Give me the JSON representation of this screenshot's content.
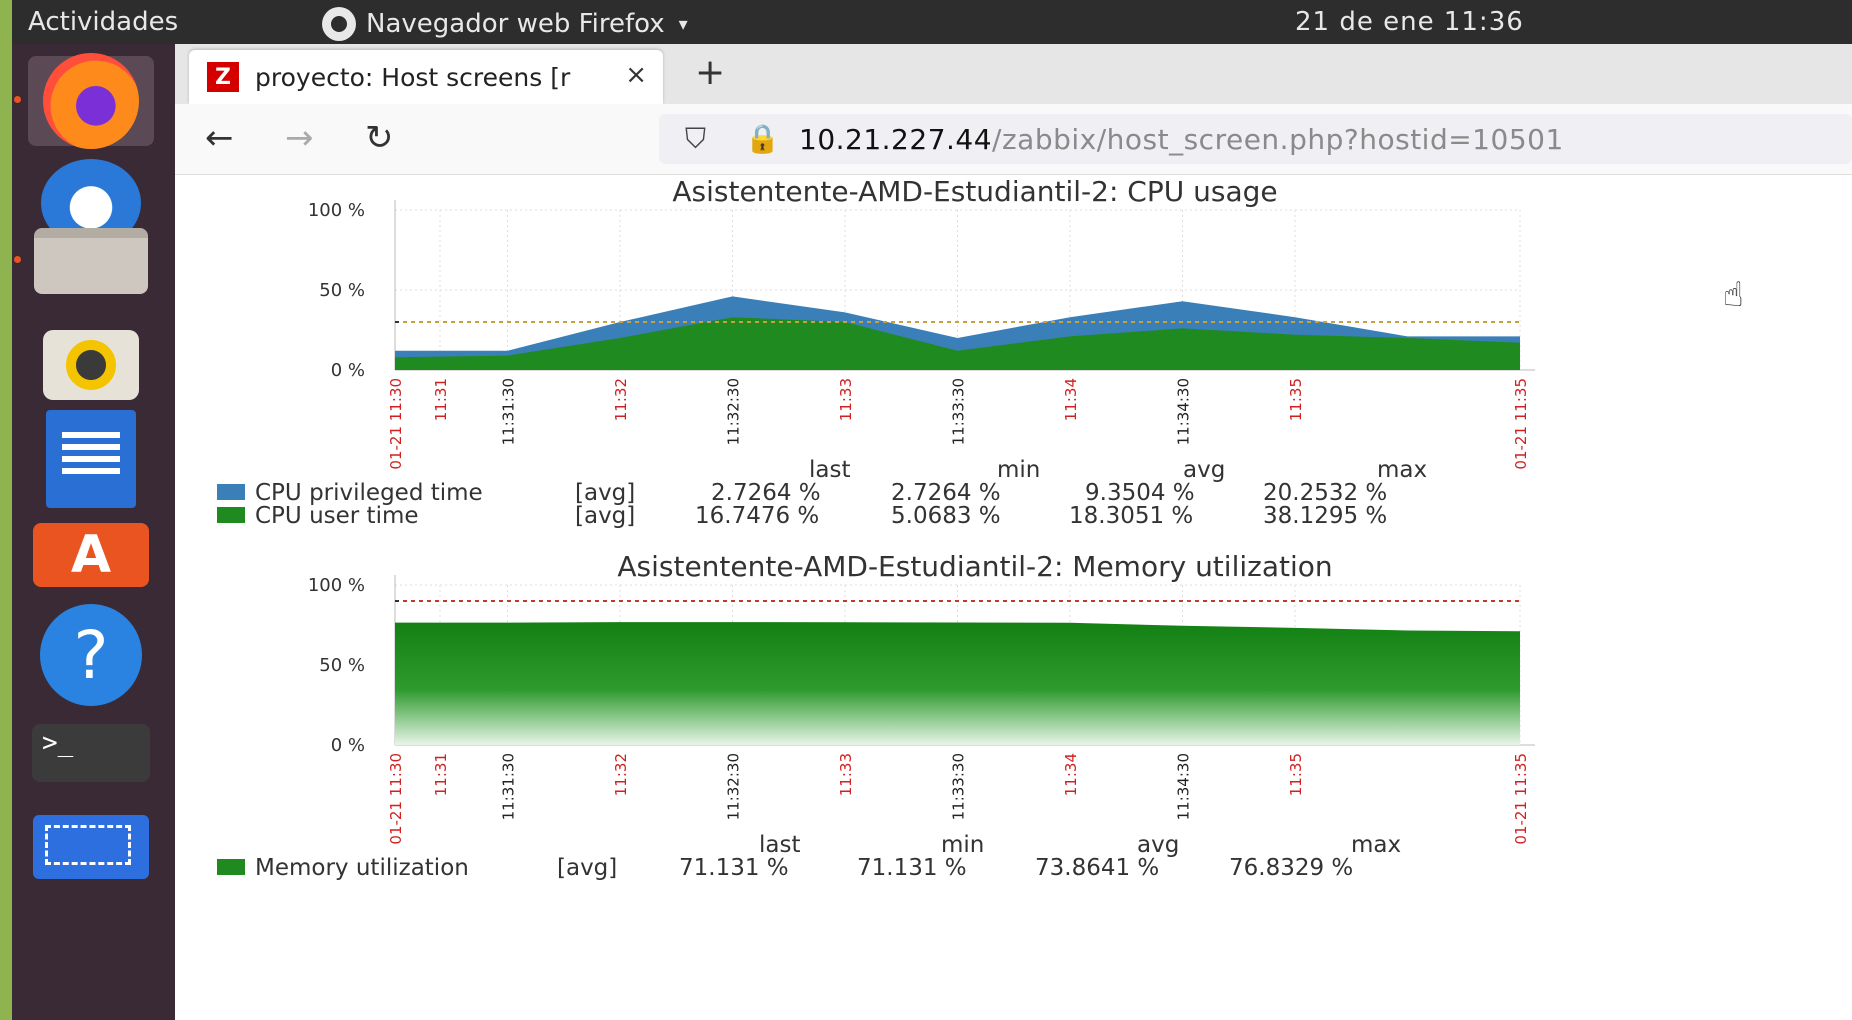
{
  "topbar": {
    "activities": "Actividades",
    "app_name": "Navegador web Firefox",
    "app_caret": "▾",
    "clock": "21 de ene  11:36"
  },
  "dock": {
    "items": [
      "firefox-icon",
      "thunderbird-icon",
      "files-icon",
      "rhythmbox-icon",
      "writer-icon",
      "software-icon",
      "help-icon",
      "terminal-icon",
      "screenshot-icon"
    ],
    "help_glyph": "?",
    "store_glyph": "A",
    "terminal_glyph": ">_"
  },
  "browser": {
    "tab": {
      "favicon": "Z",
      "title": "proyecto: Host screens [r",
      "close": "×"
    },
    "new_tab": "+",
    "nav": {
      "back": "←",
      "forward": "→",
      "reload": "↻"
    },
    "url_icons": {
      "shield": "⛉",
      "lock": "🔒"
    },
    "url": {
      "host": "10.21.227.44",
      "path": "/zabbix/host_screen.php?hostid=10501"
    }
  },
  "colors": {
    "accent": "#e95420",
    "series_blue": "#3a7fb8",
    "series_green": "#1f8a1f",
    "trigger_line": "#c8a03c",
    "time_red": "#d02020"
  },
  "cursor": "☝",
  "chart_data": [
    {
      "type": "area",
      "title": "Asistentente-AMD-Estudiantil-2: CPU usage",
      "ylim": [
        0,
        100
      ],
      "y_ticks": [
        "100 %",
        "50 %",
        "0 %"
      ],
      "x_ticks": [
        {
          "label": "01-21 11:30",
          "color": "red"
        },
        {
          "label": "11:31",
          "color": "red"
        },
        {
          "label": "11:31:30",
          "color": "black"
        },
        {
          "label": "11:32",
          "color": "red"
        },
        {
          "label": "11:32:30",
          "color": "black"
        },
        {
          "label": "11:33",
          "color": "red"
        },
        {
          "label": "11:33:30",
          "color": "black"
        },
        {
          "label": "11:34",
          "color": "red"
        },
        {
          "label": "11:34:30",
          "color": "black"
        },
        {
          "label": "11:35",
          "color": "red"
        },
        {
          "label": "01-21 11:35",
          "color": "red"
        }
      ],
      "x_minutes": [
        0,
        0.5,
        1.5,
        2.5,
        3.5,
        4.5,
        5.5,
        5.0
      ],
      "trigger_line": 30,
      "total": {
        "x": [
          0,
          0.5,
          1,
          1.5,
          2,
          2.5,
          3,
          3.5,
          4,
          4.5,
          5
        ],
        "values": [
          12,
          12,
          30,
          46,
          36,
          20,
          33,
          43,
          33,
          21,
          21
        ]
      },
      "user": {
        "x": [
          0,
          0.5,
          1,
          1.5,
          2,
          2.5,
          3,
          3.5,
          4,
          4.5,
          5
        ],
        "values": [
          8,
          9,
          20,
          33,
          30,
          12,
          21,
          26,
          22,
          20,
          17
        ]
      },
      "legend_headers": [
        "last",
        "min",
        "avg",
        "max"
      ],
      "series": [
        {
          "name": "CPU privileged time",
          "func": "[avg]",
          "last": "2.7264 %",
          "min": "2.7264 %",
          "avg": "9.3504 %",
          "max": "20.2532 %"
        },
        {
          "name": "CPU user time",
          "func": "[avg]",
          "last": "16.7476 %",
          "min": "5.0683 %",
          "avg": "18.3051 %",
          "max": "38.1295 %"
        }
      ]
    },
    {
      "type": "area",
      "title": "Asistentente-AMD-Estudiantil-2: Memory utilization",
      "ylim": [
        0,
        100
      ],
      "y_ticks": [
        "100 %",
        "50 %",
        "0 %"
      ],
      "x_ticks": [
        {
          "label": "01-21 11:30",
          "color": "red"
        },
        {
          "label": "11:31",
          "color": "red"
        },
        {
          "label": "11:31:30",
          "color": "black"
        },
        {
          "label": "11:32",
          "color": "red"
        },
        {
          "label": "11:32:30",
          "color": "black"
        },
        {
          "label": "11:33",
          "color": "red"
        },
        {
          "label": "11:33:30",
          "color": "black"
        },
        {
          "label": "11:34",
          "color": "red"
        },
        {
          "label": "11:34:30",
          "color": "black"
        },
        {
          "label": "11:35",
          "color": "red"
        },
        {
          "label": "01-21 11:35",
          "color": "red"
        }
      ],
      "trigger_line": 90,
      "memory": {
        "x": [
          0,
          0.5,
          1,
          1.5,
          2,
          2.5,
          3,
          3.5,
          4,
          4.5,
          5
        ],
        "values": [
          76.5,
          76.5,
          76.8,
          76.8,
          76.7,
          76.6,
          76.4,
          74.5,
          73.2,
          71.6,
          71.1
        ]
      },
      "legend_headers": [
        "last",
        "min",
        "avg",
        "max"
      ],
      "series": [
        {
          "name": "Memory utilization",
          "func": "[avg]",
          "last": "71.131 %",
          "min": "71.131 %",
          "avg": "73.8641 %",
          "max": "76.8329 %"
        }
      ]
    }
  ]
}
